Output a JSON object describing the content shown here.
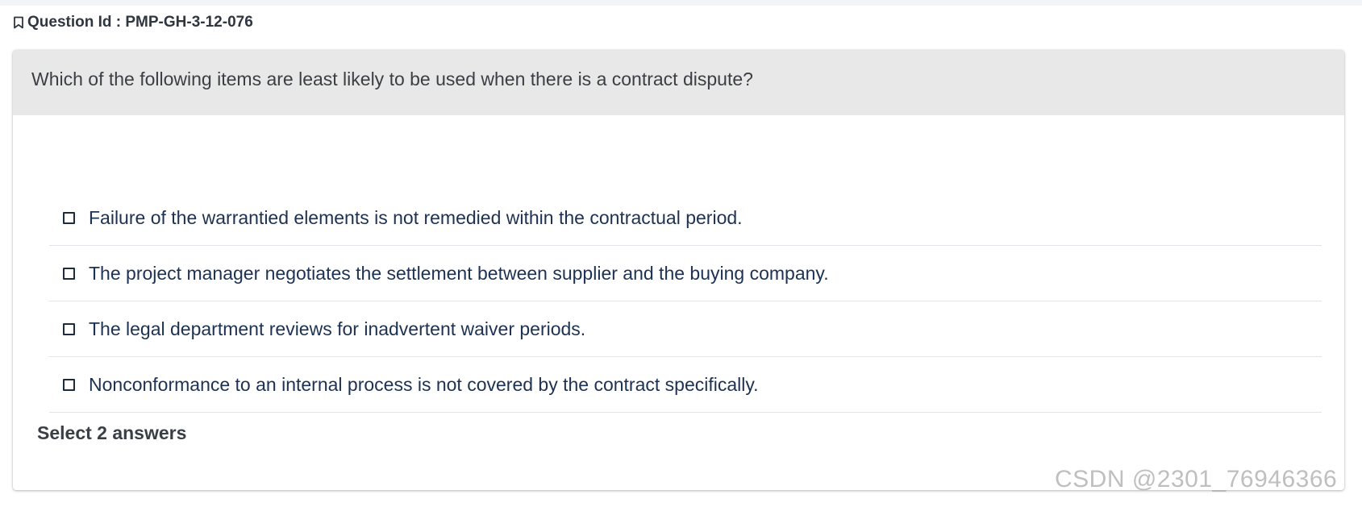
{
  "question": {
    "id_label": "Question Id : PMP-GH-3-12-076",
    "text": "Which of the following items are least likely to be used when there is a contract dispute?",
    "options": [
      {
        "label": "Failure of the warrantied elements is not remedied within the contractual period.",
        "checked": false
      },
      {
        "label": "The project manager negotiates the settlement between supplier and the buying company.",
        "checked": false
      },
      {
        "label": "The legal department reviews for inadvertent waiver periods.",
        "checked": false
      },
      {
        "label": "Nonconformance to an internal process is not covered by the contract specifically.",
        "checked": false
      }
    ],
    "hint": "Select 2 answers"
  },
  "icons": {
    "bookmark": "bookmark-icon",
    "checkbox": "checkbox-empty-icon"
  },
  "watermark": "CSDN @2301_76946366",
  "colors": {
    "header_bg": "#e8e8e8",
    "option_text": "#1d3252",
    "divider": "#e1e4e8"
  }
}
